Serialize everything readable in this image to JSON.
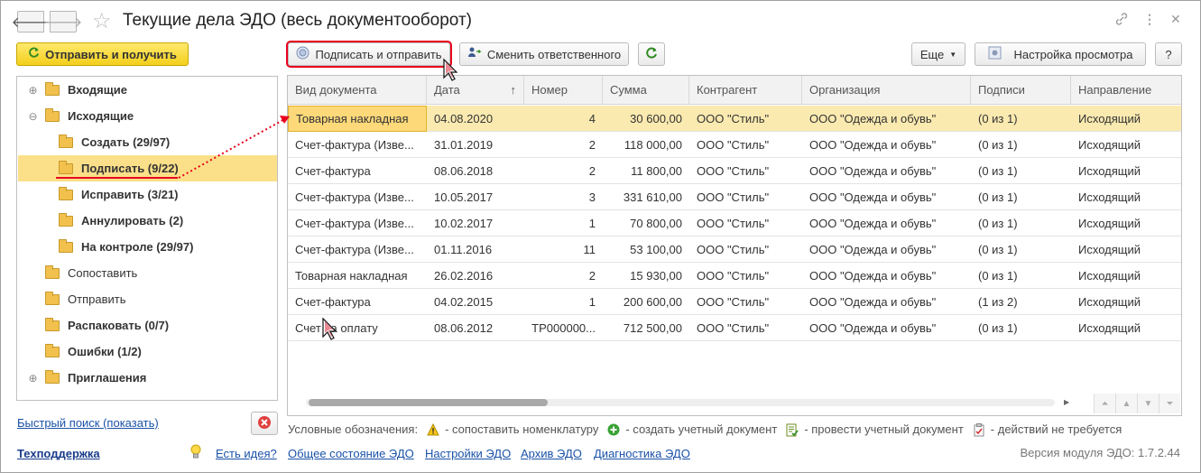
{
  "window": {
    "title": "Текущие дела ЭДО (весь документооборот)"
  },
  "toolbar": {
    "send_receive": "Отправить и получить",
    "sign_send": "Подписать и отправить",
    "change_responsible": "Сменить ответственного",
    "more": "Еще",
    "view_settings": "Настройка просмотра",
    "help": "?"
  },
  "tree": [
    {
      "label": "Входящие",
      "bold": true,
      "level": 0,
      "expander": "+"
    },
    {
      "label": "Исходящие",
      "bold": true,
      "level": 0,
      "expander": "−"
    },
    {
      "label": "Создать (29/97)",
      "bold": true,
      "level": 1
    },
    {
      "label": "Подписать (9/22)",
      "bold": true,
      "level": 1,
      "selected": true
    },
    {
      "label": "Исправить (3/21)",
      "bold": true,
      "level": 1
    },
    {
      "label": "Аннулировать (2)",
      "bold": true,
      "level": 1
    },
    {
      "label": "На контроле (29/97)",
      "bold": true,
      "level": 1
    },
    {
      "label": "Сопоставить",
      "bold": false,
      "level": 0
    },
    {
      "label": "Отправить",
      "bold": false,
      "level": 0
    },
    {
      "label": "Распаковать (0/7)",
      "bold": true,
      "level": 0
    },
    {
      "label": "Ошибки (1/2)",
      "bold": true,
      "level": 0
    },
    {
      "label": "Приглашения",
      "bold": true,
      "level": 0,
      "expander": "+"
    }
  ],
  "grid": {
    "columns": [
      "Вид документа",
      "Дата",
      "Номер",
      "Сумма",
      "Контрагент",
      "Организация",
      "Подписи",
      "Направление"
    ],
    "sort_indicator": "↑",
    "rows": [
      [
        "Товарная накладная",
        "04.08.2020",
        "4",
        "30 600,00",
        "ООО \"Стиль\"",
        "ООО \"Одежда и обувь\"",
        "(0 из 1)",
        "Исходящий"
      ],
      [
        "Счет-фактура (Изве...",
        "31.01.2019",
        "2",
        "118 000,00",
        "ООО \"Стиль\"",
        "ООО \"Одежда и обувь\"",
        "(0 из 1)",
        "Исходящий"
      ],
      [
        "Счет-фактура",
        "08.06.2018",
        "2",
        "11 800,00",
        "ООО \"Стиль\"",
        "ООО \"Одежда и обувь\"",
        "(0 из 1)",
        "Исходящий"
      ],
      [
        "Счет-фактура (Изве...",
        "10.05.2017",
        "3",
        "331 610,00",
        "ООО \"Стиль\"",
        "ООО \"Одежда и обувь\"",
        "(0 из 1)",
        "Исходящий"
      ],
      [
        "Счет-фактура (Изве...",
        "10.02.2017",
        "1",
        "70 800,00",
        "ООО \"Стиль\"",
        "ООО \"Одежда и обувь\"",
        "(0 из 1)",
        "Исходящий"
      ],
      [
        "Счет-фактура (Изве...",
        "01.11.2016",
        "11",
        "53 100,00",
        "ООО \"Стиль\"",
        "ООО \"Одежда и обувь\"",
        "(0 из 1)",
        "Исходящий"
      ],
      [
        "Товарная накладная",
        "26.02.2016",
        "2",
        "15 930,00",
        "ООО \"Стиль\"",
        "ООО \"Одежда и обувь\"",
        "(0 из 1)",
        "Исходящий"
      ],
      [
        "Счет-фактура",
        "04.02.2015",
        "1",
        "200 600,00",
        "ООО \"Стиль\"",
        "ООО \"Одежда и обувь\"",
        "(1 из 2)",
        "Исходящий"
      ],
      [
        "Счет на оплату",
        "08.06.2012",
        "ТР000000...",
        "712 500,00",
        "ООО \"Стиль\"",
        "ООО \"Одежда и обувь\"",
        "(0 из 1)",
        "Исходящий"
      ]
    ]
  },
  "legend": {
    "label": "Условные обозначения:",
    "items": [
      "- сопоставить номенклатуру",
      "- создать учетный документ",
      "- провести учетный документ",
      "- действий не требуется"
    ]
  },
  "footer": {
    "quick_search": "Быстрый поиск (показать)",
    "support": "Техподдержка",
    "idea": "Есть идея?",
    "status": "Общее состояние ЭДО",
    "settings": "Настройки ЭДО",
    "archive": "Архив ЭДО",
    "diagnostics": "Диагностика ЭДО",
    "version": "Версия модуля ЭДО: 1.7.2.44"
  },
  "colors": {
    "accent_yellow": "#f3cf1b",
    "selection": "#fbe089",
    "link": "#1a52a8",
    "annotation_red": "#e8001c"
  }
}
